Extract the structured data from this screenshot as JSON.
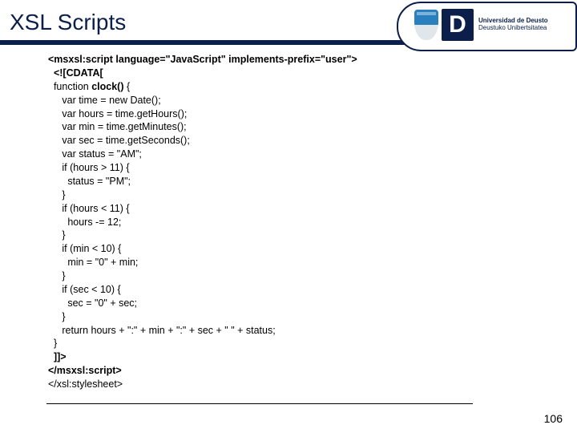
{
  "header": {
    "title": "XSL Scripts",
    "logo": {
      "big_letter": "D",
      "line1": "Universidad de Deusto",
      "line2": "Deustuko Unibertsitatea"
    }
  },
  "code": {
    "tag_open": "<msxsl:script language=\"JavaScript\" implements-prefix=\"user\">",
    "cdata_open": "<![CDATA[",
    "fn_sig_pre": "function ",
    "fn_name": "clock()",
    "fn_sig_post": " {",
    "l1": "   var time = new Date();",
    "l2": "   var hours = time.getHours();",
    "l3": "   var min = time.getMinutes();",
    "l4": "   var sec = time.getSeconds();",
    "l5": "   var status = \"AM\";",
    "l6": "   if (hours > 11) {",
    "l7": "     status = \"PM\";",
    "l8": "   }",
    "l9": "   if (hours < 11) {",
    "l10": "     hours -= 12;",
    "l11": "   }",
    "l12": "   if (min < 10) {",
    "l13": "     min = \"0\" + min;",
    "l14": "   }",
    "l15": "   if (sec < 10) {",
    "l16": "     sec = \"0\" + sec;",
    "l17": "   }",
    "l18": "   return hours + \":\" + min + \":\" + sec + \" \" + status;",
    "l19": "}",
    "cdata_close": "]]>",
    "tag_close": "</msxsl:script>",
    "sheet_close": "</xsl:stylesheet>"
  },
  "page_number": "106"
}
